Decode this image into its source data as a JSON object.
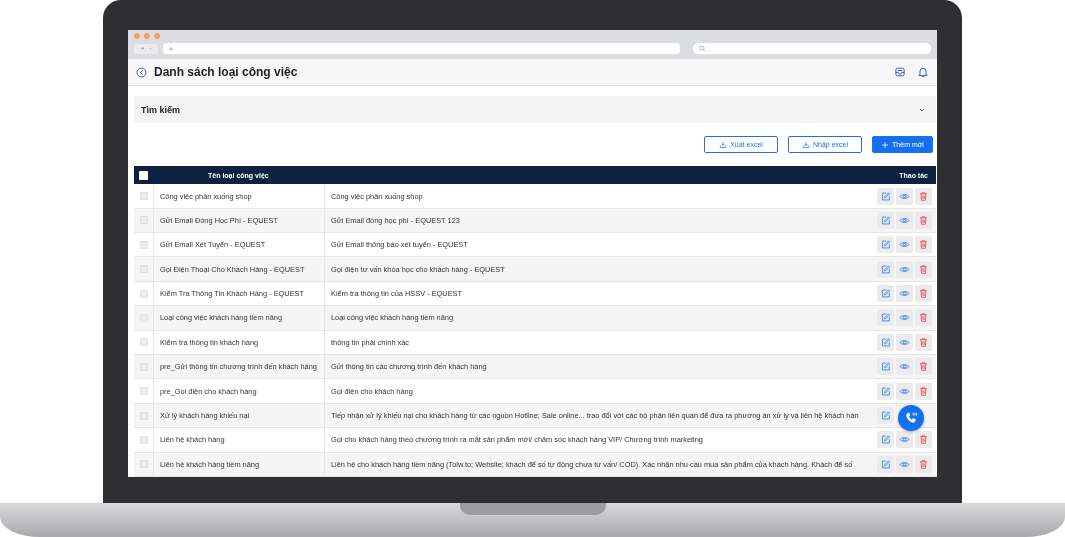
{
  "header": {
    "title": "Danh sách loại công việc"
  },
  "search_panel": {
    "label": "Tìm kiếm",
    "expanded": false
  },
  "buttons": [
    {
      "label": "Xuất excel",
      "kind": "outline"
    },
    {
      "label": "Nhập excel",
      "kind": "outline"
    },
    {
      "label": "Thêm mới",
      "kind": "primary"
    }
  ],
  "table": {
    "select_all_checked": false,
    "columns": [
      "Tên loại công việc",
      "Thao tác"
    ],
    "rows": [
      {
        "checked": false,
        "name": "Công việc phân xuống shop",
        "description": "Công việc phân xuống shop"
      },
      {
        "checked": false,
        "name": "Gửi Email Đóng Học Phí - EQUEST",
        "description": "Gửi Email đóng học phí - EQUEST 123"
      },
      {
        "checked": false,
        "name": "Gửi Email Xét Tuyển - EQUEST",
        "description": "Gửi Email thông báo xét tuyển - EQUEST"
      },
      {
        "checked": false,
        "name": "Gọi Điện Thoại Cho Khách Hàng - EQUEST",
        "description": "Gọi điện tư vấn khóa học cho khách hàng - EQUEST"
      },
      {
        "checked": false,
        "name": "Kiểm Tra Thông Tin Khách Hàng - EQUEST",
        "description": "Kiểm tra thông tin của HSSV - EQUEST"
      },
      {
        "checked": false,
        "name": "Loại công việc khách hàng tiềm năng",
        "description": "Loại công việc khách hàng tiềm năng"
      },
      {
        "checked": false,
        "name": "Kiểm tra thông tin khách hàng",
        "description": "thông tin phải chính xác"
      },
      {
        "checked": false,
        "name": "pre_Gửi thông tin chương trình đến khách hàng",
        "description": "Gửi thông tin các chương trình đến khách hàng"
      },
      {
        "checked": false,
        "name": "pre_Gọi điện cho khách hàng",
        "description": "Gọi điện cho khách hàng"
      },
      {
        "checked": false,
        "name": "Xử lý khách hàng khiếu nại",
        "description": "Tiếp nhận xử lý khiếu nại cho khách hàng từ các nguồn Hotline; Sale online... trao đổi với các bộ phận liên quan để đưa ra phương án xử lý và liên hệ khách hàn"
      },
      {
        "checked": false,
        "name": "Liên hệ khách hàng",
        "description": "Gọi cho khách hàng theo chương trình ra mắt sản phẩm mới/ chăm sóc khách hàng VIP/ Chương trình marketing"
      },
      {
        "checked": false,
        "name": "Liên hệ khách hàng tiềm năng",
        "description": "Liên hệ cho khách hàng tiềm năng (Tolw.to; Website; khách để số tự động chưa tư vấn/ COD). Xác nhận nhu cầu mua sản phẩm của khách hàng. Khách để số"
      }
    ]
  }
}
